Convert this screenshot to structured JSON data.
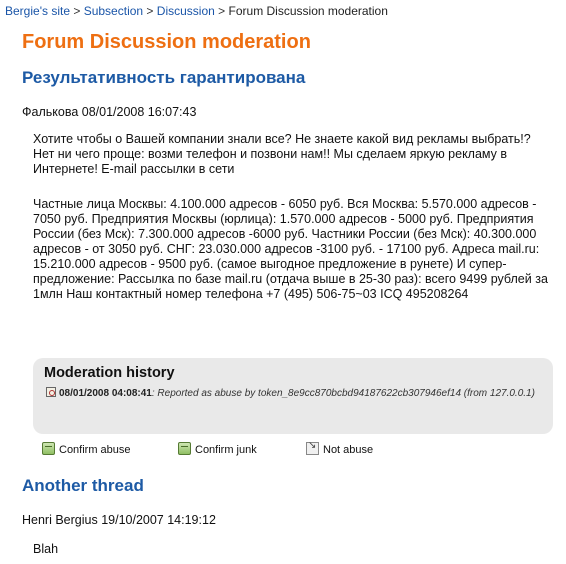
{
  "breadcrumb": {
    "items": [
      "Bergie's site",
      "Subsection",
      "Discussion"
    ],
    "current": "Forum Discussion moderation",
    "separator": ">"
  },
  "page": {
    "title": "Forum Discussion moderation"
  },
  "threads": [
    {
      "title": "Результативность гарантирована",
      "author_date": "Фалькова 08/01/2008 16:07:43",
      "paragraphs": [
        "Хотите чтобы о Вашей компании знали все? Не знаете какой вид рекламы выбрать!? Нет ни чего проще: возми телефон и позвони нам!! Мы сделаем яркую рекламу в Интернете! E-mail рассылки в сети",
        "Частные лица Москвы: 4.100.000 адресов - 6050 руб. Вся Москва: 5.570.000 адресов - 7050 руб. Предприятия Москвы (юрлица): 1.570.000 адресов - 5000 руб. Предприятия России (без Мск): 7.300.000 адресов -6000 руб. Частники России (без Мск): 40.300.000 адресов - от 3050 руб. СНГ: 23.030.000 адресов -3100 руб. - 17100 руб. Адреса mail.ru: 15.210.000 адресов - 9500 руб. (самое выгодное предложение в рунете) И супер-предложение: Рассылка по базе mail.ru (отдача выше в 25-30 раз): всего 9499 рублей за 1млн Наш контактный номер телефона +7 (495) 506-75~03 ICQ 495208264"
      ],
      "moderation": {
        "title": "Moderation history",
        "entry_timestamp": "08/01/2008 04:08:41",
        "entry_text": ": Reported as abuse by token_8e9cc870bcbd94187622cb307946ef14 (from 127.0.0.1)"
      },
      "actions": [
        {
          "label": "Confirm abuse",
          "icon": "trash-can-icon"
        },
        {
          "label": "Confirm junk",
          "icon": "trash-can-icon"
        },
        {
          "label": "Not abuse",
          "icon": "arrow-icon"
        }
      ]
    },
    {
      "title": "Another thread",
      "author_date": "Henri Bergius 19/10/2007 14:19:12",
      "paragraphs": [
        "Blah"
      ]
    }
  ],
  "colors": {
    "page_title": "#ee6f12",
    "thread_title": "#1d5aa5",
    "link": "#1a55a8",
    "mod_box": "#e9e9e9"
  }
}
